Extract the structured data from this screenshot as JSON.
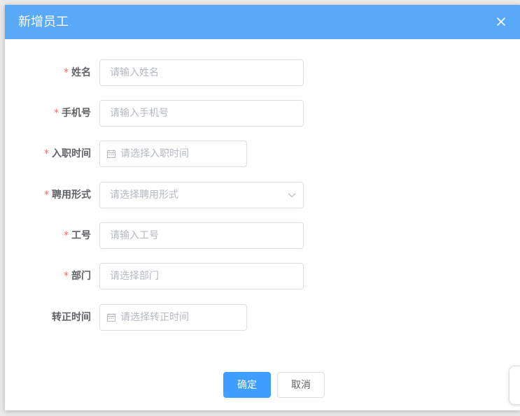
{
  "dialog": {
    "title": "新增员工",
    "colors": {
      "header": "#5aa9f8",
      "primary": "#409eff",
      "required_star": "#f56c6c"
    }
  },
  "form": {
    "fields": [
      {
        "label": "姓名",
        "required": true,
        "placeholder": "请输入姓名",
        "type": "text"
      },
      {
        "label": "手机号",
        "required": true,
        "placeholder": "请输入手机号",
        "type": "text"
      },
      {
        "label": "入职时间",
        "required": true,
        "placeholder": "请选择入职时间",
        "type": "date",
        "icon": "calendar-icon"
      },
      {
        "label": "聘用形式",
        "required": true,
        "placeholder": "请选择聘用形式",
        "type": "select",
        "icon": "chevron-down-icon"
      },
      {
        "label": "工号",
        "required": true,
        "placeholder": "请输入工号",
        "type": "text"
      },
      {
        "label": "部门",
        "required": true,
        "placeholder": "请选择部门",
        "type": "text"
      },
      {
        "label": "转正时间",
        "required": false,
        "placeholder": "请选择转正时间",
        "type": "date",
        "icon": "calendar-icon"
      }
    ],
    "required_mark": "*"
  },
  "footer": {
    "confirm_label": "确定",
    "cancel_label": "取消"
  }
}
